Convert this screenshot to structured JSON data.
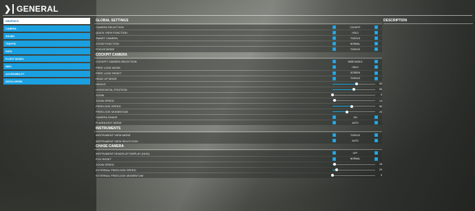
{
  "header": {
    "back_icon": "chevron-left-icon",
    "title": "GENERAL"
  },
  "sidebar": {
    "items": [
      {
        "label": "GRAPHICS",
        "active": true
      },
      {
        "label": "CAMERA",
        "active": false
      },
      {
        "label": "SOUND",
        "active": false
      },
      {
        "label": "TRAFFIC",
        "active": false
      },
      {
        "label": "DATA",
        "active": false
      },
      {
        "label": "FLIGHT MODEL",
        "active": false
      },
      {
        "label": "MISC",
        "active": false
      },
      {
        "label": "ACCESSIBILITY",
        "active": false
      },
      {
        "label": "DEVELOPERS",
        "active": false
      }
    ]
  },
  "description": {
    "title": "DESCRIPTION"
  },
  "sections": [
    {
      "title": "GLOBAL SETTINGS",
      "rows": [
        {
          "label": "CAMERA SELECTION",
          "type": "select",
          "value": "COCKPIT"
        },
        {
          "label": "QUICK VIEW FUNCTION",
          "type": "select",
          "value": "HOLD"
        },
        {
          "label": "SMART CAMERA",
          "type": "select",
          "value": "TOGGLE"
        },
        {
          "label": "ZOOM FUNCTION",
          "type": "select",
          "value": "NORMAL"
        },
        {
          "label": "FOCUS MODE",
          "type": "select",
          "value": "TOGGLE"
        }
      ]
    },
    {
      "title": "COCKPIT CAMERA",
      "rows": [
        {
          "label": "COCKPIT CAMERA SELECTION",
          "type": "select",
          "value": "WIDE ANGLE"
        },
        {
          "label": "FREE LOOK MODE",
          "type": "select",
          "value": "HOLD"
        },
        {
          "label": "FREE LOOK RESET",
          "type": "select",
          "value": "SCREEN"
        },
        {
          "label": "HEAD UP MODE",
          "type": "select",
          "value": "TOGGLE"
        },
        {
          "label": "HEIGHT",
          "type": "slider",
          "value": "50",
          "fraction": 0.56
        },
        {
          "label": "HORIZONTAL POSITION",
          "type": "slider",
          "value": "50",
          "fraction": 0.5
        },
        {
          "label": "ZOOM",
          "type": "slider",
          "value": "0",
          "fraction": 0.0
        },
        {
          "label": "ZOOM SPEED",
          "type": "slider",
          "value": "14",
          "fraction": 0.05
        },
        {
          "label": "FREELOOK SPEED",
          "type": "slider",
          "value": "50",
          "fraction": 0.45
        },
        {
          "label": "FREELOOK MOMENTUM",
          "type": "slider",
          "value": "24",
          "fraction": 0.34
        },
        {
          "label": "CAMERA SHAKE",
          "type": "select",
          "value": "ON"
        },
        {
          "label": "FLASHLIGHT MODE",
          "type": "select",
          "value": "AUTO"
        }
      ]
    },
    {
      "title": "INSTRUMENTS",
      "rows": [
        {
          "label": "INSTRUMENT VIEW MODE",
          "type": "select",
          "value": "TOGGLE"
        },
        {
          "label": "INSTRUMENT VIEW SELECTION",
          "type": "select",
          "value": "AUTO"
        }
      ]
    },
    {
      "title": "CHASE CAMERA",
      "rows": [
        {
          "label": "INSTRUMENT HEADS-UP DISPLAY (HUD)",
          "type": "select",
          "value": "OFF"
        },
        {
          "label": "POV RESET",
          "type": "select",
          "value": "NORMAL"
        },
        {
          "label": "ZOOM SPEED",
          "type": "slider",
          "value": "15",
          "fraction": 0.05
        },
        {
          "label": "EXTERNAL FREELOOK SPEED",
          "type": "slider",
          "value": "20",
          "fraction": 0.1
        },
        {
          "label": "EXTERNAL FREELOOK MOMENTUM",
          "type": "slider",
          "value": "0",
          "fraction": 0.0
        }
      ]
    }
  ],
  "colors": {
    "accent": "#1aa0e0",
    "active_item_bg": "#ffffff",
    "active_item_text": "#1d6ea8"
  }
}
